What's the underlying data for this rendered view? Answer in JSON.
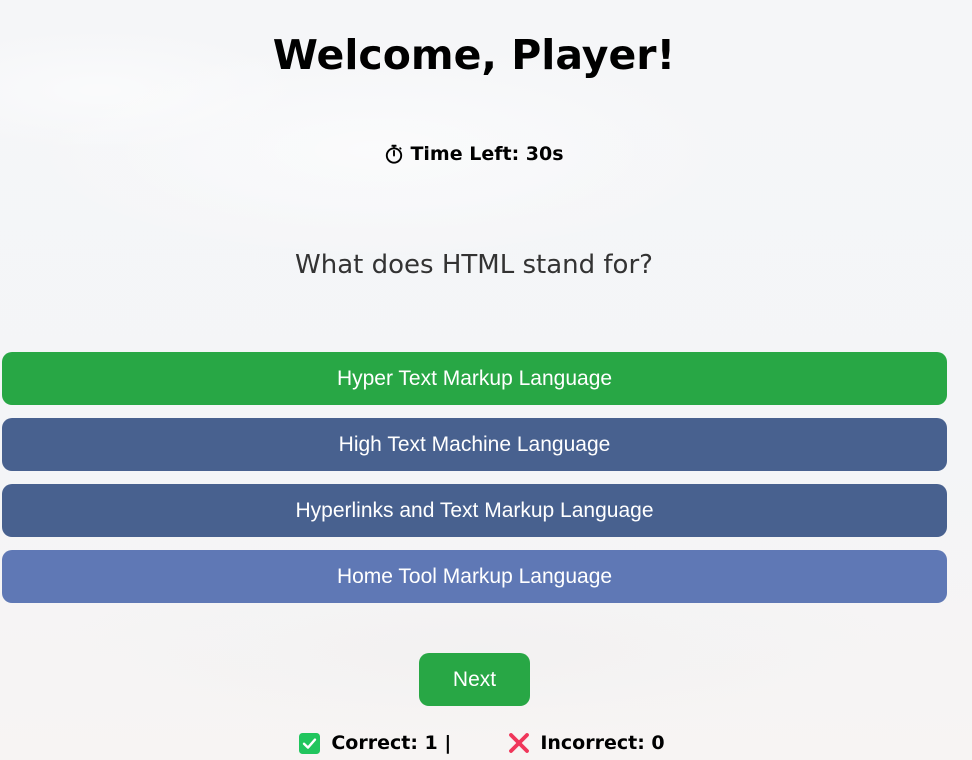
{
  "header": {
    "title": "Welcome, Player!",
    "timer_label": "Time Left: 30s"
  },
  "question": {
    "text": "What does HTML stand for?"
  },
  "options": [
    {
      "label": "Hyper Text Markup Language",
      "color": "#28a745",
      "state": "correct"
    },
    {
      "label": "High Text Machine Language",
      "color": "#48618f",
      "state": "default"
    },
    {
      "label": "Hyperlinks and Text Markup Language",
      "color": "#48618f",
      "state": "default"
    },
    {
      "label": "Home Tool Markup Language",
      "color": "#5f78b5",
      "state": "hover"
    }
  ],
  "actions": {
    "next_label": "Next"
  },
  "score": {
    "correct_label": "Correct: 1 |",
    "incorrect_label": "Incorrect: 0"
  },
  "icons": {
    "timer": "stopwatch-icon",
    "correct": "check-mark-icon",
    "incorrect": "cross-mark-icon"
  },
  "colors": {
    "correct_green": "#28a745",
    "option_blue": "#48618f",
    "option_hover_blue": "#5f78b5",
    "check_green": "#21c55d",
    "cross_red": "#f0365a"
  }
}
